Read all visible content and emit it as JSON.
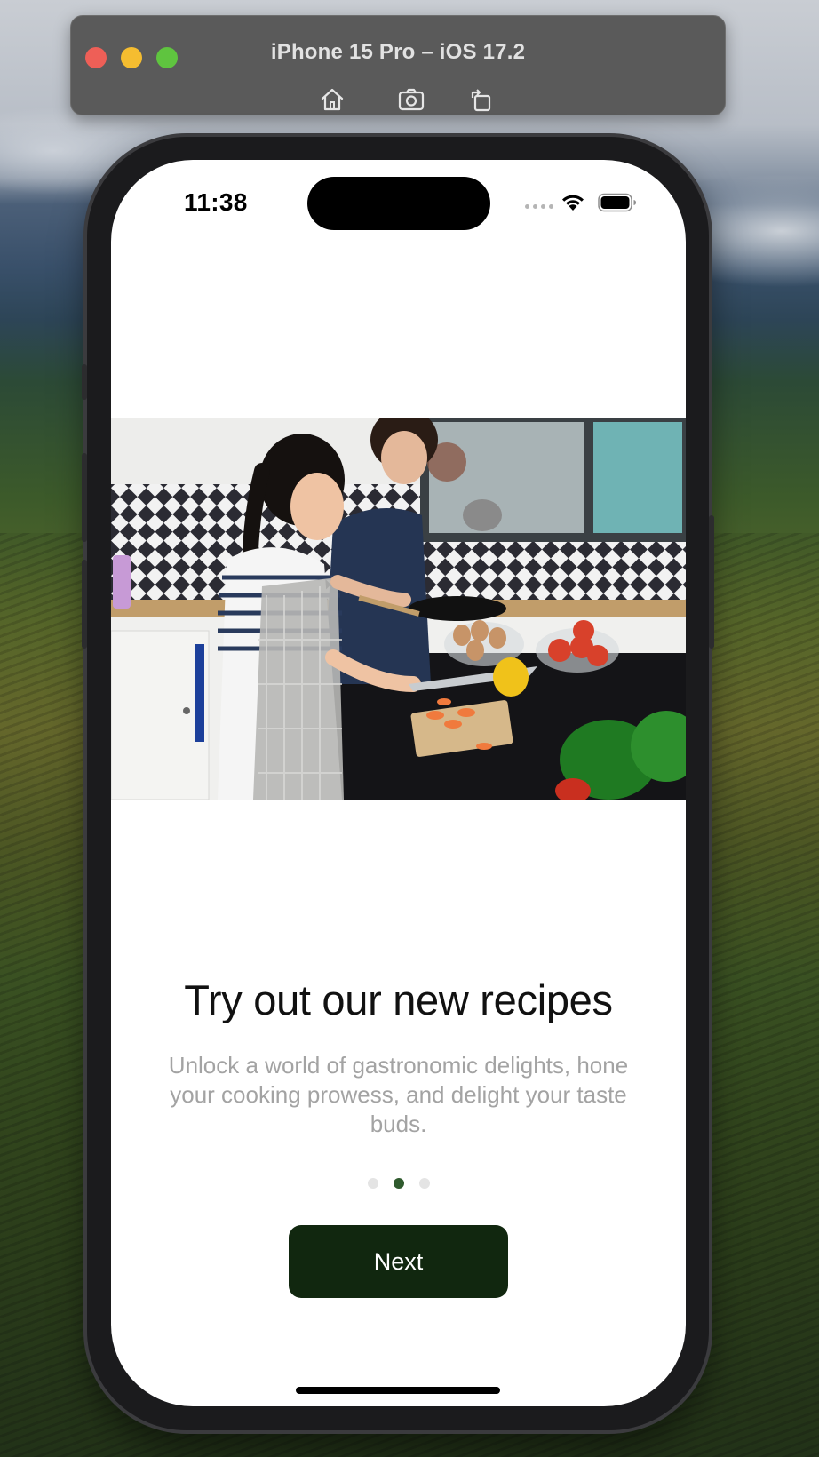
{
  "simulator": {
    "title": "iPhone 15 Pro – iOS 17.2",
    "toolbar": [
      {
        "icon": "home-icon"
      },
      {
        "icon": "screenshot-icon"
      },
      {
        "icon": "rotate-icon"
      }
    ]
  },
  "status_bar": {
    "time": "11:38",
    "icons": [
      "cellular-icon",
      "wifi-icon",
      "battery-icon"
    ]
  },
  "onboarding": {
    "title": "Try out our new recipes",
    "subtitle": "Unlock a world of gastronomic delights, hone your cooking prowess, and delight your taste buds.",
    "page_count": 3,
    "active_page": 2,
    "next_label": "Next"
  },
  "colors": {
    "button_bg": "#11270f",
    "active_dot": "#2f5a2d",
    "inactive_dot": "#e4e4e4",
    "subtitle": "#a3a3a3"
  }
}
